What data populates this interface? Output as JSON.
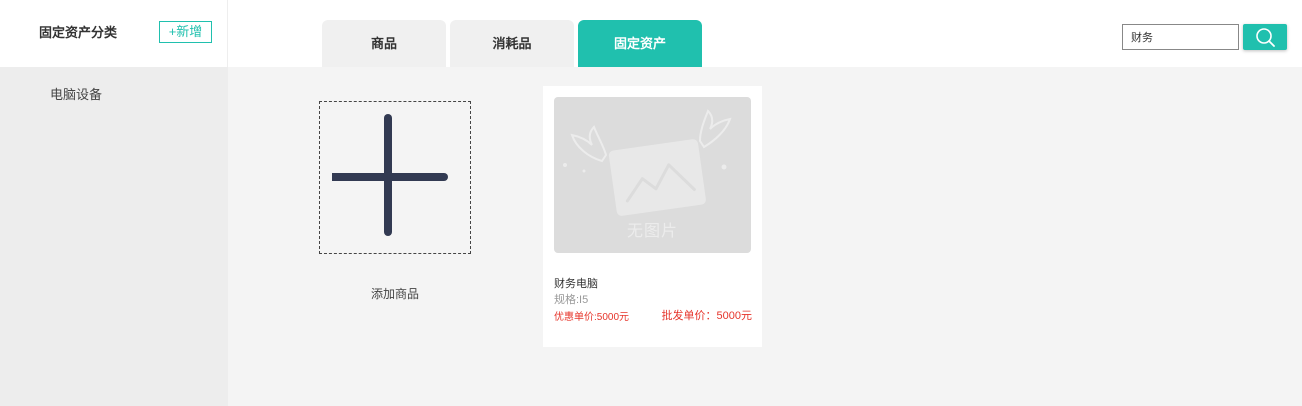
{
  "sidebar": {
    "title": "固定资产分类",
    "add_label": "+新增",
    "items": [
      {
        "label": "电脑设备"
      }
    ]
  },
  "tabs": [
    {
      "label": "商品",
      "active": false
    },
    {
      "label": "消耗品",
      "active": false
    },
    {
      "label": "固定资产",
      "active": true
    }
  ],
  "search": {
    "value": "财务",
    "button_icon": "search-icon"
  },
  "main": {
    "add_product_label": "添加商品",
    "products": [
      {
        "name": "财务电脑",
        "spec": "规格:I5",
        "discount_price": "优惠单价:5000元",
        "wholesale_price": "批发单价：5000元",
        "image_placeholder": "无图片"
      }
    ]
  },
  "colors": {
    "accent": "#20c0ae",
    "price": "#e6352b",
    "sidebar_bg": "#ededed",
    "main_bg": "#f4f4f4"
  }
}
